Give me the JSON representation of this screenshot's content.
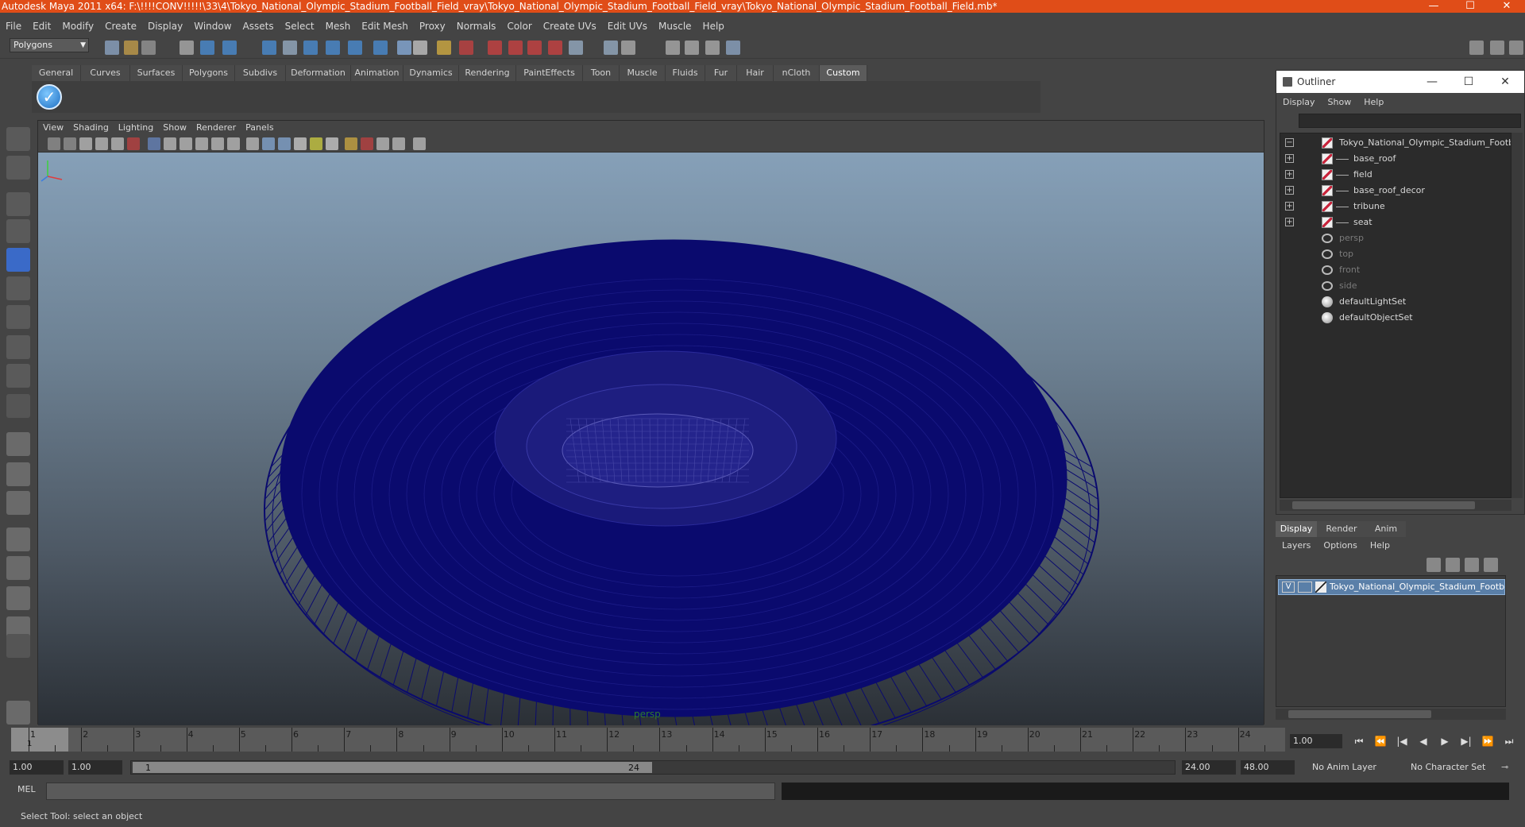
{
  "window": {
    "title": "Autodesk Maya 2011 x64: F:\\!!!!CONV!!!!!\\33\\4\\Tokyo_National_Olympic_Stadium_Football_Field_vray\\Tokyo_National_Olympic_Stadium_Football_Field_vray\\Tokyo_National_Olympic_Stadium_Football_Field.mb*",
    "minimize": "—",
    "maximize": "☐",
    "close": "✕"
  },
  "menubar": [
    "File",
    "Edit",
    "Modify",
    "Create",
    "Display",
    "Window",
    "Assets",
    "Select",
    "Mesh",
    "Edit Mesh",
    "Proxy",
    "Normals",
    "Color",
    "Create UVs",
    "Edit UVs",
    "Muscle",
    "Help"
  ],
  "statusline": {
    "mode": "Polygons"
  },
  "shelf": {
    "tabs": [
      "General",
      "Curves",
      "Surfaces",
      "Polygons",
      "Subdivs",
      "Deformation",
      "Animation",
      "Dynamics",
      "Rendering",
      "PaintEffects",
      "Toon",
      "Muscle",
      "Fluids",
      "Fur",
      "Hair",
      "nCloth",
      "Custom"
    ],
    "active_tab": "Custom"
  },
  "viewport": {
    "menu": [
      "View",
      "Shading",
      "Lighting",
      "Show",
      "Renderer",
      "Panels"
    ],
    "camera": "persp",
    "wire_color": "#0a0a6e"
  },
  "outliner": {
    "title": "Outliner",
    "menu": [
      "Display",
      "Show",
      "Help"
    ],
    "items": [
      {
        "label": "Tokyo_National_Olympic_Stadium_Football_F",
        "type": "mesh",
        "expand": "−",
        "indent": 0
      },
      {
        "label": "base_roof",
        "type": "mesh",
        "expand": "+",
        "indent": 1
      },
      {
        "label": "field",
        "type": "mesh",
        "expand": "+",
        "indent": 1
      },
      {
        "label": "base_roof_decor",
        "type": "mesh",
        "expand": "+",
        "indent": 1
      },
      {
        "label": "tribune",
        "type": "mesh",
        "expand": "+",
        "indent": 1
      },
      {
        "label": "seat",
        "type": "mesh",
        "expand": "+",
        "indent": 1
      },
      {
        "label": "persp",
        "type": "camera",
        "expand": "",
        "indent": 0
      },
      {
        "label": "top",
        "type": "camera",
        "expand": "",
        "indent": 0
      },
      {
        "label": "front",
        "type": "camera",
        "expand": "",
        "indent": 0
      },
      {
        "label": "side",
        "type": "camera",
        "expand": "",
        "indent": 0
      },
      {
        "label": "defaultLightSet",
        "type": "set",
        "expand": "",
        "indent": 0
      },
      {
        "label": "defaultObjectSet",
        "type": "set",
        "expand": "",
        "indent": 0
      }
    ]
  },
  "layer_editor": {
    "tabs": [
      "Display",
      "Render",
      "Anim"
    ],
    "active_tab": "Display",
    "menu": [
      "Layers",
      "Options",
      "Help"
    ],
    "layer": {
      "visible": "V",
      "name": "Tokyo_National_Olympic_Stadium_Football_F"
    }
  },
  "timeline": {
    "ticks": [
      "1",
      "2",
      "3",
      "4",
      "5",
      "6",
      "7",
      "8",
      "9",
      "10",
      "11",
      "12",
      "13",
      "14",
      "15",
      "16",
      "17",
      "18",
      "19",
      "20",
      "21",
      "22",
      "23",
      "24"
    ],
    "current_frame": "1",
    "current_time_field": "1.00",
    "playback_buttons": [
      "⏮",
      "⏪",
      "|◀",
      "◀",
      "▶",
      "▶|",
      "⏩",
      "⏭"
    ]
  },
  "range": {
    "start_time": "1.00",
    "playback_start": "1.00",
    "slider_start": "1",
    "slider_end": "24",
    "playback_end": "24.00",
    "end_time": "48.00",
    "anim_layer": "No Anim Layer",
    "character_set": "No Character Set"
  },
  "command_line": {
    "label": "MEL"
  },
  "help_line": "Select Tool: select an object"
}
